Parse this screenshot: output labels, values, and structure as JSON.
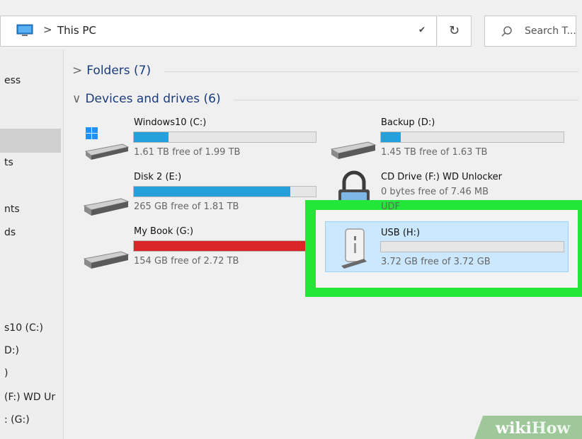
{
  "address": {
    "icon": "this-pc-icon",
    "separator": ">",
    "location": "This PC",
    "dropdown_icon": "chevron-down-icon",
    "refresh_icon": "refresh-icon"
  },
  "search": {
    "placeholder": "Search T...",
    "icon": "search-icon"
  },
  "nav": {
    "items": [
      "ess",
      "ts",
      "nts",
      "ds",
      "s10 (C:)",
      "D:)",
      ")",
      "(F:) WD Ur",
      ": (G:)"
    ]
  },
  "groups": {
    "folders": {
      "chevron": ">",
      "label": "Folders (7)"
    },
    "devices": {
      "chevron": "∨",
      "label": "Devices and drives (6)"
    }
  },
  "drives": [
    {
      "name": "Windows10 (C:)",
      "free": "1.61 TB free of 1.99 TB",
      "used_fraction": 0.19,
      "bar_color": "#26a0da",
      "icon": "windows-drive-icon"
    },
    {
      "name": "Backup (D:)",
      "free": "1.45 TB free of 1.63 TB",
      "used_fraction": 0.11,
      "bar_color": "#26a0da",
      "icon": "hard-drive-icon"
    },
    {
      "name": "Disk 2 (E:)",
      "free": "265 GB free of 1.81 TB",
      "used_fraction": 0.86,
      "bar_color": "#26a0da",
      "icon": "hard-drive-icon"
    },
    {
      "name": "CD Drive (F:) WD Unlocker",
      "free": "0 bytes free of 7.46 MB",
      "extra": "UDF",
      "icon": "locked-drive-icon"
    },
    {
      "name": "My Book (G:)",
      "free": "154 GB free of 2.72 TB",
      "used_fraction": 0.94,
      "bar_color": "#da2626",
      "icon": "hard-drive-icon"
    },
    {
      "name": "USB (H:)",
      "free": "3.72 GB free of 3.72 GB",
      "used_fraction": 0.0,
      "bar_color": "#26a0da",
      "icon": "usb-drive-icon"
    }
  ],
  "highlight_color": "#22e63a",
  "watermark": {
    "prefix": "wiki",
    "suffix": "How"
  }
}
